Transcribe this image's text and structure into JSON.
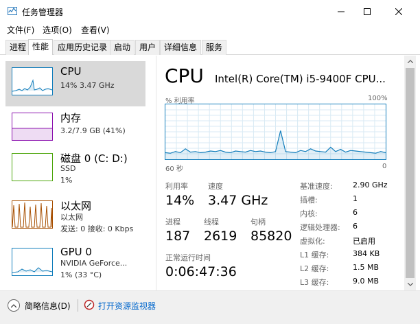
{
  "window": {
    "title": "任务管理器",
    "minimize_icon": "minimize-icon",
    "maximize_icon": "maximize-icon",
    "close_icon": "close-icon"
  },
  "menu": [
    "文件(F)",
    "选项(O)",
    "查看(V)"
  ],
  "tabs": [
    "进程",
    "性能",
    "应用历史记录",
    "启动",
    "用户",
    "详细信息",
    "服务"
  ],
  "active_tab": "性能",
  "resources": [
    {
      "title": "CPU",
      "sub1": "14% 3.47 GHz",
      "sub2": "",
      "color": "#117dbb",
      "selected": true
    },
    {
      "title": "内存",
      "sub1": "3.2/7.9 GB (41%)",
      "sub2": "",
      "color": "#8b12ae",
      "selected": false
    },
    {
      "title": "磁盘 0 (C: D:)",
      "sub1": "SSD",
      "sub2": "1%",
      "color": "#4da60c",
      "selected": false
    },
    {
      "title": "以太网",
      "sub1": "以太网",
      "sub2": "发送: 0 接收: 0 Kbps",
      "color": "#a74f01",
      "selected": false
    },
    {
      "title": "GPU 0",
      "sub1": "NVIDIA GeForce...",
      "sub2": "1% (33 °C)",
      "color": "#117dbb",
      "selected": false
    }
  ],
  "detail": {
    "heading": "CPU",
    "model": "Intel(R) Core(TM) i5-9400F CPU...",
    "util_label": "% 利用率",
    "max_label": "100%",
    "time_label": "60 秒",
    "zero_label": "0",
    "utilization_label": "利用率",
    "utilization": "14%",
    "speed_label": "速度",
    "speed": "3.47 GHz",
    "processes_label": "进程",
    "processes": "187",
    "threads_label": "线程",
    "threads": "2619",
    "handles_label": "句柄",
    "handles": "85820",
    "uptime_label": "正常运行时间",
    "uptime": "0:06:47:36",
    "specs": [
      {
        "label": "基准速度:",
        "value": "2.90 GHz"
      },
      {
        "label": "插槽:",
        "value": "1"
      },
      {
        "label": "内核:",
        "value": "6"
      },
      {
        "label": "逻辑处理器:",
        "value": "6"
      },
      {
        "label": "虚拟化:",
        "value": "已启用"
      },
      {
        "label": "L1 缓存:",
        "value": "384 KB"
      },
      {
        "label": "L2 缓存:",
        "value": "1.5 MB"
      },
      {
        "label": "L3 缓存:",
        "value": "9.0 MB"
      }
    ],
    "graph_values": [
      12,
      11,
      14,
      12,
      19,
      13,
      14,
      12,
      13,
      15,
      14,
      16,
      13,
      12,
      15,
      14,
      13,
      16,
      14,
      15,
      13,
      12,
      14,
      52,
      14,
      13,
      12,
      16,
      14,
      19,
      15,
      14,
      13,
      22,
      14,
      18,
      13,
      16,
      15,
      14,
      13,
      12,
      11,
      14,
      12
    ]
  },
  "footer": {
    "fewer_details": "简略信息(D)",
    "open_monitor": "打开资源监视器"
  }
}
